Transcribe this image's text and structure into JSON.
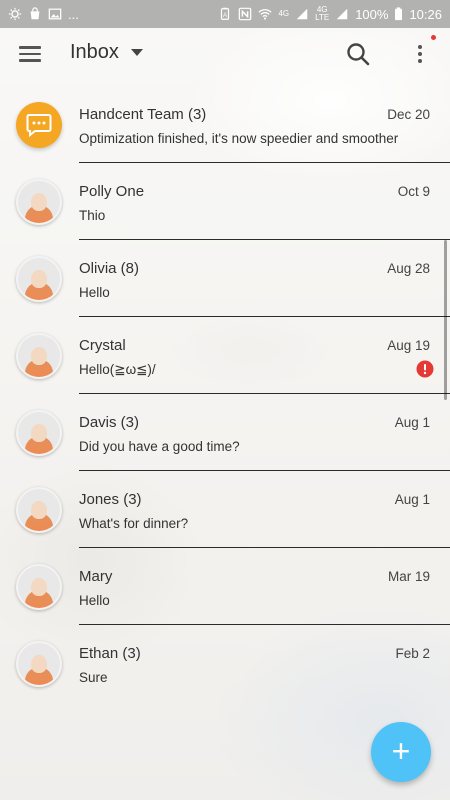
{
  "status_bar": {
    "left_icons": [
      "settings-icon",
      "bag-icon",
      "image-icon"
    ],
    "left_more": "...",
    "battery_percent": "100%",
    "time": "10:26",
    "network_1": "4G",
    "network_2": "4G",
    "network_sub": "LTE"
  },
  "app_bar": {
    "title": "Inbox",
    "menu_icon": "hamburger-menu-icon",
    "search_icon": "search-icon",
    "more_icon": "more-vert-icon",
    "notification_dot_color": "#e53935"
  },
  "conversations": [
    {
      "name": "Handcent Team (3)",
      "date": "Dec 20",
      "preview": "Optimization finished, it's now speedier and smoother",
      "avatar": "brand",
      "error": false
    },
    {
      "name": "Polly One",
      "date": "Oct 9",
      "preview": "Thio",
      "avatar": "contact",
      "error": false
    },
    {
      "name": "Olivia (8)",
      "date": "Aug 28",
      "preview": "Hello",
      "avatar": "contact",
      "error": false
    },
    {
      "name": "Crystal",
      "date": "Aug 19",
      "preview": "Hello(≧ω≦)/",
      "avatar": "contact",
      "error": true
    },
    {
      "name": "Davis (3)",
      "date": "Aug 1",
      "preview": "Did you have a good time?",
      "avatar": "contact",
      "error": false
    },
    {
      "name": "Jones (3)",
      "date": "Aug 1",
      "preview": "What's for dinner?",
      "avatar": "contact",
      "error": false
    },
    {
      "name": "Mary",
      "date": "Mar 19",
      "preview": "Hello",
      "avatar": "contact",
      "error": false
    },
    {
      "name": "Ethan (3)",
      "date": "Feb 2",
      "preview": "Sure",
      "avatar": "contact",
      "error": false
    }
  ],
  "fab": {
    "label": "+",
    "icon": "add-icon",
    "color": "#4fc3f7"
  },
  "colors": {
    "brand_avatar": "#f5a623",
    "error": "#e53935",
    "divider": "#2b2b2b"
  }
}
